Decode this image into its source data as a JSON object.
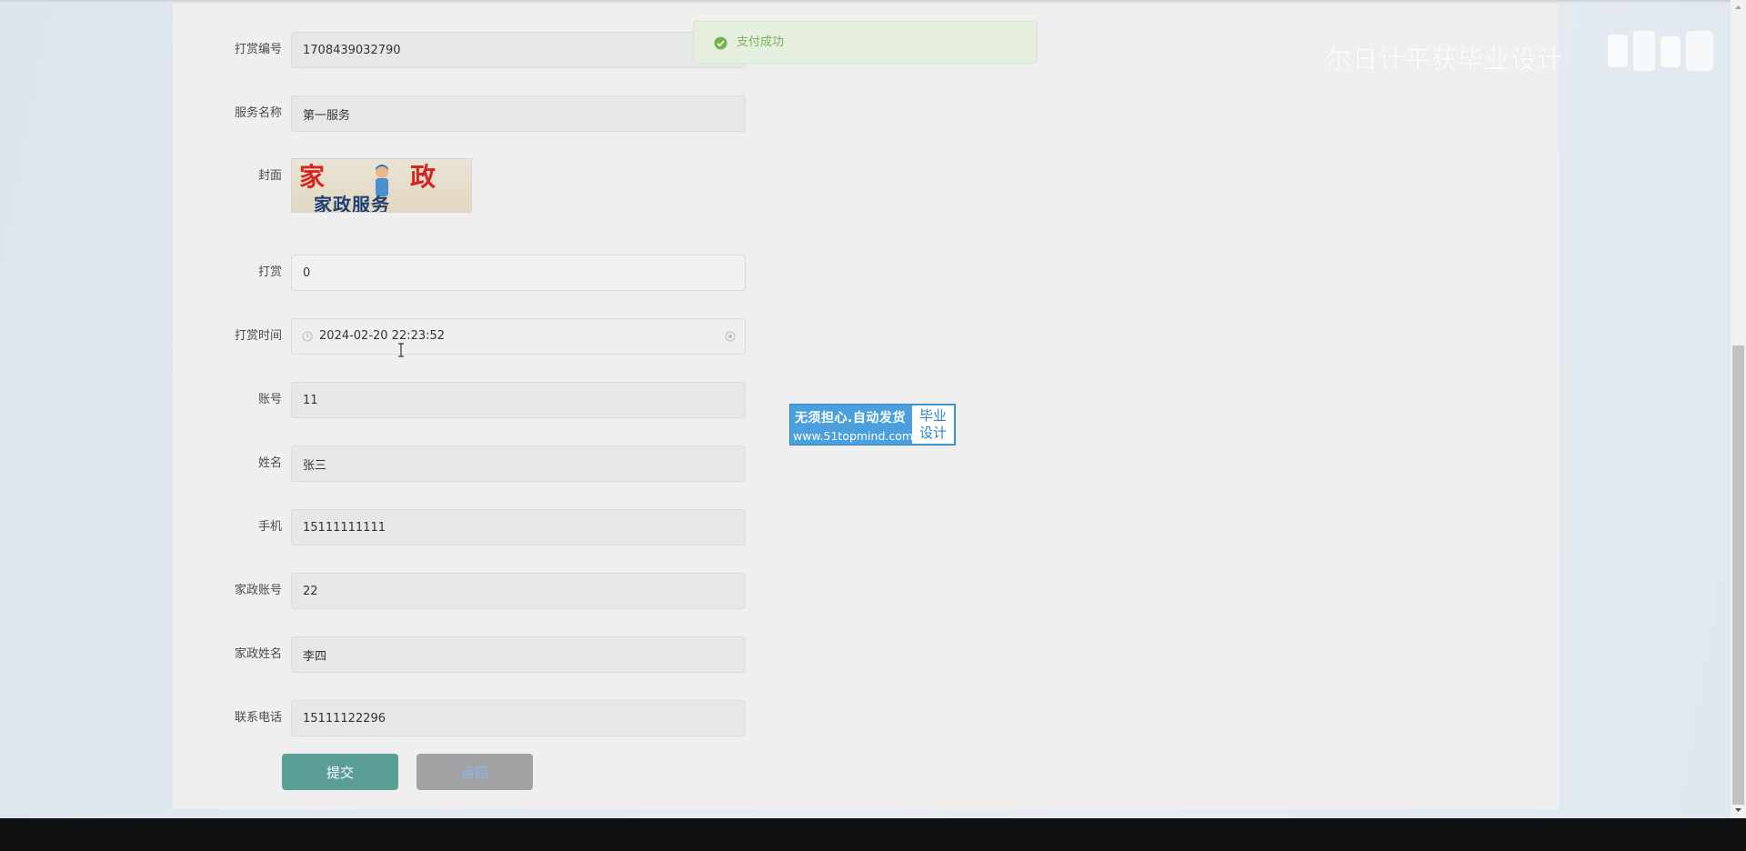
{
  "toast": {
    "message": "支付成功"
  },
  "form": {
    "fields": [
      {
        "label": "打赏编号",
        "value": "1708439032790"
      },
      {
        "label": "服务名称",
        "value": "第一服务"
      },
      {
        "label": "打赏",
        "value": "0"
      },
      {
        "label": "打赏时间",
        "value": "2024-02-20 22:23:52"
      },
      {
        "label": "账号",
        "value": "11"
      },
      {
        "label": "姓名",
        "value": "张三"
      },
      {
        "label": "手机",
        "value": "15111111111"
      },
      {
        "label": "家政账号",
        "value": "22"
      },
      {
        "label": "家政姓名",
        "value": "李四"
      },
      {
        "label": "联系电话",
        "value": "15111122296"
      }
    ],
    "cover": {
      "label": "封面",
      "image_text_top_left": "家",
      "image_text_top_right": "政",
      "image_text_bottom": "家政服务"
    },
    "submit_label": "提交",
    "back_label": "返回"
  },
  "ad": {
    "line1": "无须担心.自动发货",
    "line2": "www.51topmind.com",
    "side_line1": "毕业",
    "side_line2": "设计"
  },
  "watermark": {
    "text": "尔日计平获毕业设计"
  },
  "colors": {
    "submit": "#5a9e97",
    "back": "#a2a2a4",
    "toast_bg": "#e6eedf",
    "toast_text": "#7ab357",
    "ad_blue": "#4a9fdc",
    "taskbar": "#0f1012"
  }
}
